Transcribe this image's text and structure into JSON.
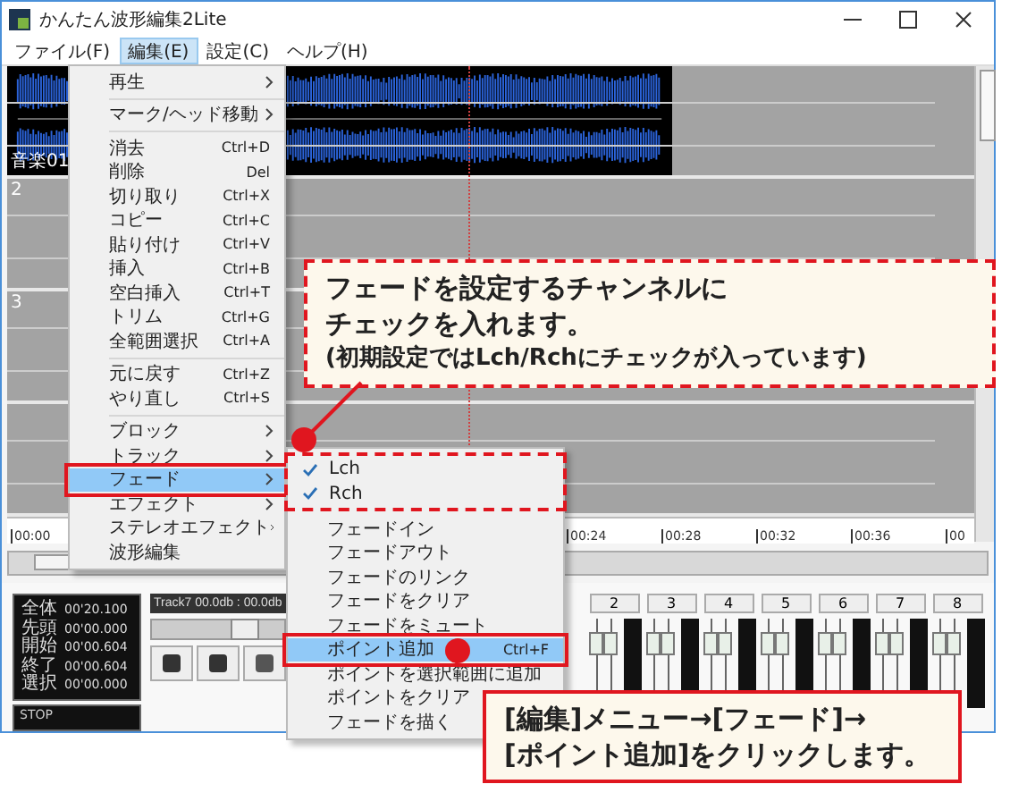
{
  "window": {
    "title": "かんたん波形編集2Lite"
  },
  "menu_bar": [
    {
      "label": "ファイル(F)",
      "selected": false
    },
    {
      "label": "編集(E)",
      "selected": true
    },
    {
      "label": "設定(C)",
      "selected": false
    },
    {
      "label": "ヘルプ(H)",
      "selected": false
    }
  ],
  "tracks": [
    {
      "kind": "audio",
      "label": "音楽01"
    },
    {
      "kind": "empty",
      "label": "2"
    },
    {
      "kind": "empty",
      "label": "3"
    },
    {
      "kind": "empty"
    }
  ],
  "timeline_ticks": [
    "00:00",
    "00:24",
    "00:28",
    "00:32",
    "00:36",
    "00"
  ],
  "info_panel": {
    "rows": [
      {
        "label": "全体",
        "value": "00'20.100"
      },
      {
        "label": "先頭",
        "value": "00'00.000"
      },
      {
        "label": "開始",
        "value": "00'00.604"
      },
      {
        "label": "終了",
        "value": "00'00.604"
      },
      {
        "label": "選択",
        "value": "00'00.000"
      }
    ],
    "status": "STOP"
  },
  "track_strip": {
    "label": "Track7 00.0db : 00.0db",
    "level": 0.7
  },
  "mixer_channels": [
    "2",
    "3",
    "4",
    "5",
    "6",
    "7",
    "8"
  ],
  "edit_menu": {
    "items": [
      {
        "kind": "submenu",
        "label": "再生",
        "selected": false
      },
      {
        "kind": "separator"
      },
      {
        "kind": "submenu",
        "label": "マーク/ヘッド移動",
        "selected": false
      },
      {
        "kind": "separator"
      },
      {
        "kind": "command",
        "label": "消去",
        "shortcut": "Ctrl+D",
        "selected": false
      },
      {
        "kind": "command",
        "label": "削除",
        "shortcut": "Del",
        "selected": false
      },
      {
        "kind": "command",
        "label": "切り取り",
        "shortcut": "Ctrl+X",
        "selected": false
      },
      {
        "kind": "command",
        "label": "コピー",
        "shortcut": "Ctrl+C",
        "selected": false
      },
      {
        "kind": "command",
        "label": "貼り付け",
        "shortcut": "Ctrl+V",
        "selected": false
      },
      {
        "kind": "command",
        "label": "挿入",
        "shortcut": "Ctrl+B",
        "selected": false
      },
      {
        "kind": "command",
        "label": "空白挿入",
        "shortcut": "Ctrl+T",
        "selected": false
      },
      {
        "kind": "command",
        "label": "トリム",
        "shortcut": "Ctrl+G",
        "selected": false
      },
      {
        "kind": "command",
        "label": "全範囲選択",
        "shortcut": "Ctrl+A",
        "selected": false
      },
      {
        "kind": "separator"
      },
      {
        "kind": "command",
        "label": "元に戻す",
        "shortcut": "Ctrl+Z",
        "selected": false
      },
      {
        "kind": "command",
        "label": "やり直し",
        "shortcut": "Ctrl+S",
        "selected": false
      },
      {
        "kind": "separator"
      },
      {
        "kind": "submenu",
        "label": "ブロック",
        "selected": false
      },
      {
        "kind": "submenu",
        "label": "トラック",
        "selected": false
      },
      {
        "kind": "submenu",
        "label": "フェード",
        "selected": true
      },
      {
        "kind": "submenu",
        "label": "エフェクト",
        "selected": false
      },
      {
        "kind": "submenu",
        "label": "ステレオエフェクト",
        "selected": false
      },
      {
        "kind": "command",
        "label": "波形編集",
        "selected": false
      }
    ]
  },
  "fade_submenu": {
    "items": [
      {
        "kind": "check",
        "label": "Lch",
        "checked": true,
        "selected": false
      },
      {
        "kind": "check",
        "label": "Rch",
        "checked": true,
        "selected": false
      },
      {
        "kind": "command",
        "label": "フェードイン",
        "selected": false
      },
      {
        "kind": "command",
        "label": "フェードアウト",
        "selected": false
      },
      {
        "kind": "command",
        "label": "フェードのリンク",
        "selected": false
      },
      {
        "kind": "command",
        "label": "フェードをクリア",
        "selected": false
      },
      {
        "kind": "command",
        "label": "フェードをミュート",
        "selected": false
      },
      {
        "kind": "command",
        "label": "ポイント追加",
        "shortcut": "Ctrl+F",
        "selected": true
      },
      {
        "kind": "command",
        "label": "ポイントを選択範囲に追加",
        "selected": false
      },
      {
        "kind": "command",
        "label": "ポイントをクリア",
        "selected": false
      },
      {
        "kind": "command",
        "label": "フェードを描く",
        "selected": false
      }
    ]
  },
  "callouts": [
    {
      "lines": [
        "フェードを設定するチャンネルに",
        "チェックを入れます。",
        "(初期設定ではLch/Rchにチェックが入っています)"
      ]
    },
    {
      "lines": [
        "[編集]メニュー→[フェード]→",
        "[ポイント追加]をクリックします。"
      ]
    }
  ]
}
